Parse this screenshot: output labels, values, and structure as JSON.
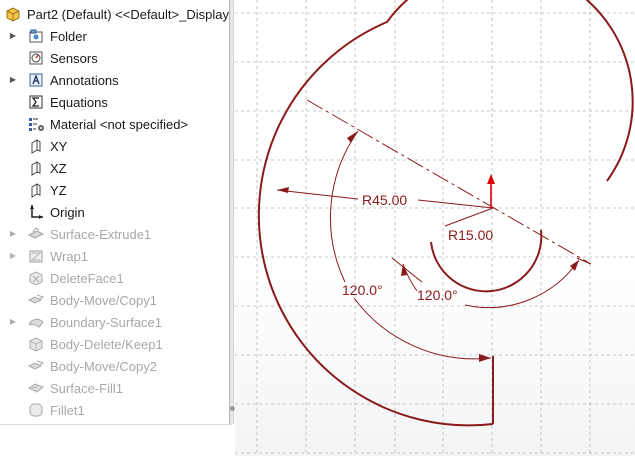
{
  "feature_tree": {
    "root_label": "Part2 (Default) <<Default>_Display",
    "items": [
      {
        "label": "Folder",
        "icon": "folder-icon",
        "expandable": true,
        "disabled": false
      },
      {
        "label": "Sensors",
        "icon": "sensor-icon",
        "expandable": false,
        "disabled": false
      },
      {
        "label": "Annotations",
        "icon": "annotations-icon",
        "expandable": true,
        "disabled": false
      },
      {
        "label": "Equations",
        "icon": "equations-icon",
        "expandable": false,
        "disabled": false
      },
      {
        "label": "Material <not specified>",
        "icon": "material-icon",
        "expandable": false,
        "disabled": false
      },
      {
        "label": "XY",
        "icon": "plane-icon",
        "expandable": false,
        "disabled": false
      },
      {
        "label": "XZ",
        "icon": "plane-icon",
        "expandable": false,
        "disabled": false
      },
      {
        "label": "YZ",
        "icon": "plane-icon",
        "expandable": false,
        "disabled": false
      },
      {
        "label": "Origin",
        "icon": "origin-icon",
        "expandable": false,
        "disabled": false
      },
      {
        "label": "Surface-Extrude1",
        "icon": "surface-extrude-icon",
        "expandable": true,
        "disabled": true
      },
      {
        "label": "Wrap1",
        "icon": "wrap-icon",
        "expandable": true,
        "disabled": true
      },
      {
        "label": "DeleteFace1",
        "icon": "delete-face-icon",
        "expandable": false,
        "disabled": true
      },
      {
        "label": "Body-Move/Copy1",
        "icon": "body-move-icon",
        "expandable": false,
        "disabled": true
      },
      {
        "label": "Boundary-Surface1",
        "icon": "boundary-surface-icon",
        "expandable": true,
        "disabled": true
      },
      {
        "label": "Body-Delete/Keep1",
        "icon": "body-delete-icon",
        "expandable": false,
        "disabled": true
      },
      {
        "label": "Body-Move/Copy2",
        "icon": "body-move-icon",
        "expandable": false,
        "disabled": true
      },
      {
        "label": "Surface-Fill1",
        "icon": "surface-fill-icon",
        "expandable": false,
        "disabled": true
      },
      {
        "label": "Fillet1",
        "icon": "fillet-icon",
        "expandable": false,
        "disabled": true
      }
    ]
  },
  "sketch": {
    "dimensions": {
      "outer_radius": "R45.00",
      "inner_radius": "R15.00",
      "angle_outer": "120.0°",
      "angle_inner": "120.0°"
    },
    "colors": {
      "sketch_curve": "#8b1a1a",
      "dimension": "#8b1a1a",
      "grid": "#b8b8b8",
      "origin_arrow": "#e00000"
    }
  }
}
